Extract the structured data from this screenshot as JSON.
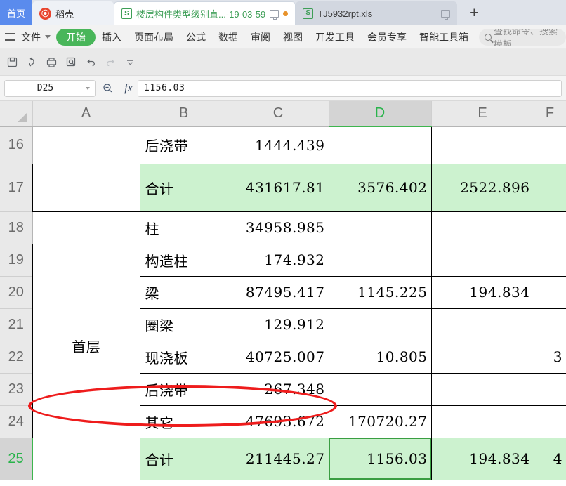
{
  "window": {
    "tabs": [
      {
        "label": "首页",
        "type": "home",
        "icon": "home-tab"
      },
      {
        "label": "稻壳",
        "type": "docer",
        "icon": "docer-logo-icon"
      },
      {
        "label": "楼层构件类型级别直...-19-03-59",
        "type": "active",
        "icon": "spreadsheet-s-icon",
        "unsaved": true
      },
      {
        "label": "TJ5932rpt.xls",
        "type": "inactive",
        "icon": "spreadsheet-s-icon",
        "unsaved": false
      }
    ],
    "new_tab_label": "+"
  },
  "menubar": {
    "file_label": "文件",
    "items": [
      {
        "label": "开始",
        "active": true
      },
      {
        "label": "插入",
        "active": false
      },
      {
        "label": "页面布局",
        "active": false
      },
      {
        "label": "公式",
        "active": false
      },
      {
        "label": "数据",
        "active": false
      },
      {
        "label": "审阅",
        "active": false
      },
      {
        "label": "视图",
        "active": false
      },
      {
        "label": "开发工具",
        "active": false
      },
      {
        "label": "会员专享",
        "active": false
      },
      {
        "label": "智能工具箱",
        "active": false
      }
    ],
    "search_placeholder": "查找命令、搜索模板"
  },
  "quick_access": {
    "buttons": [
      {
        "name": "save-icon"
      },
      {
        "name": "share-icon"
      },
      {
        "name": "print-icon"
      },
      {
        "name": "print-preview-icon"
      },
      {
        "name": "undo-icon"
      },
      {
        "name": "redo-icon"
      },
      {
        "name": "customize-dropdown-icon"
      }
    ]
  },
  "formula_bar": {
    "name_box_value": "D25",
    "fx_label": "fx",
    "formula_value": "1156.03"
  },
  "sheet": {
    "columns": [
      "A",
      "B",
      "C",
      "D",
      "E",
      "F"
    ],
    "selected_column": "D",
    "selected_row": "25",
    "selected_cell": "D25",
    "rows": [
      {
        "num": "16",
        "cells": {
          "A": "",
          "B": "后浇带",
          "C": "1444.439",
          "D": "",
          "E": "",
          "F": ""
        },
        "green": false
      },
      {
        "num": "17",
        "cells": {
          "A": "",
          "B": "合计",
          "C": "431617.81",
          "D": "3576.402",
          "E": "2522.896",
          "F": ""
        },
        "green": true
      },
      {
        "num": "18",
        "cells": {
          "A": "首层",
          "B": "柱",
          "C": "34958.985",
          "D": "",
          "E": "",
          "F": ""
        },
        "green": false
      },
      {
        "num": "19",
        "cells": {
          "A": "",
          "B": "构造柱",
          "C": "174.932",
          "D": "",
          "E": "",
          "F": ""
        },
        "green": false
      },
      {
        "num": "20",
        "cells": {
          "A": "",
          "B": "梁",
          "C": "87495.417",
          "D": "1145.225",
          "E": "194.834",
          "F": ""
        },
        "green": false
      },
      {
        "num": "21",
        "cells": {
          "A": "",
          "B": "圈梁",
          "C": "129.912",
          "D": "",
          "E": "",
          "F": ""
        },
        "green": false
      },
      {
        "num": "22",
        "cells": {
          "A": "",
          "B": "现浇板",
          "C": "40725.007",
          "D": "10.805",
          "E": "",
          "F": "3"
        },
        "green": false
      },
      {
        "num": "23",
        "cells": {
          "A": "",
          "B": "后浇带",
          "C": "267.348",
          "D": "",
          "E": "",
          "F": ""
        },
        "green": false
      },
      {
        "num": "24",
        "cells": {
          "A": "",
          "B": "其它",
          "C": "47693.672",
          "D": "170720.27",
          "E": "",
          "F": ""
        },
        "green": false
      },
      {
        "num": "25",
        "cells": {
          "A": "",
          "B": "合计",
          "C": "211445.27",
          "D": "1156.03",
          "E": "194.834",
          "F": "4"
        },
        "green": true
      }
    ],
    "merged_a_label": "首层"
  },
  "annotation": {
    "type": "red-ellipse",
    "target_cells": "B24:C24",
    "color": "#ee1c1c"
  }
}
